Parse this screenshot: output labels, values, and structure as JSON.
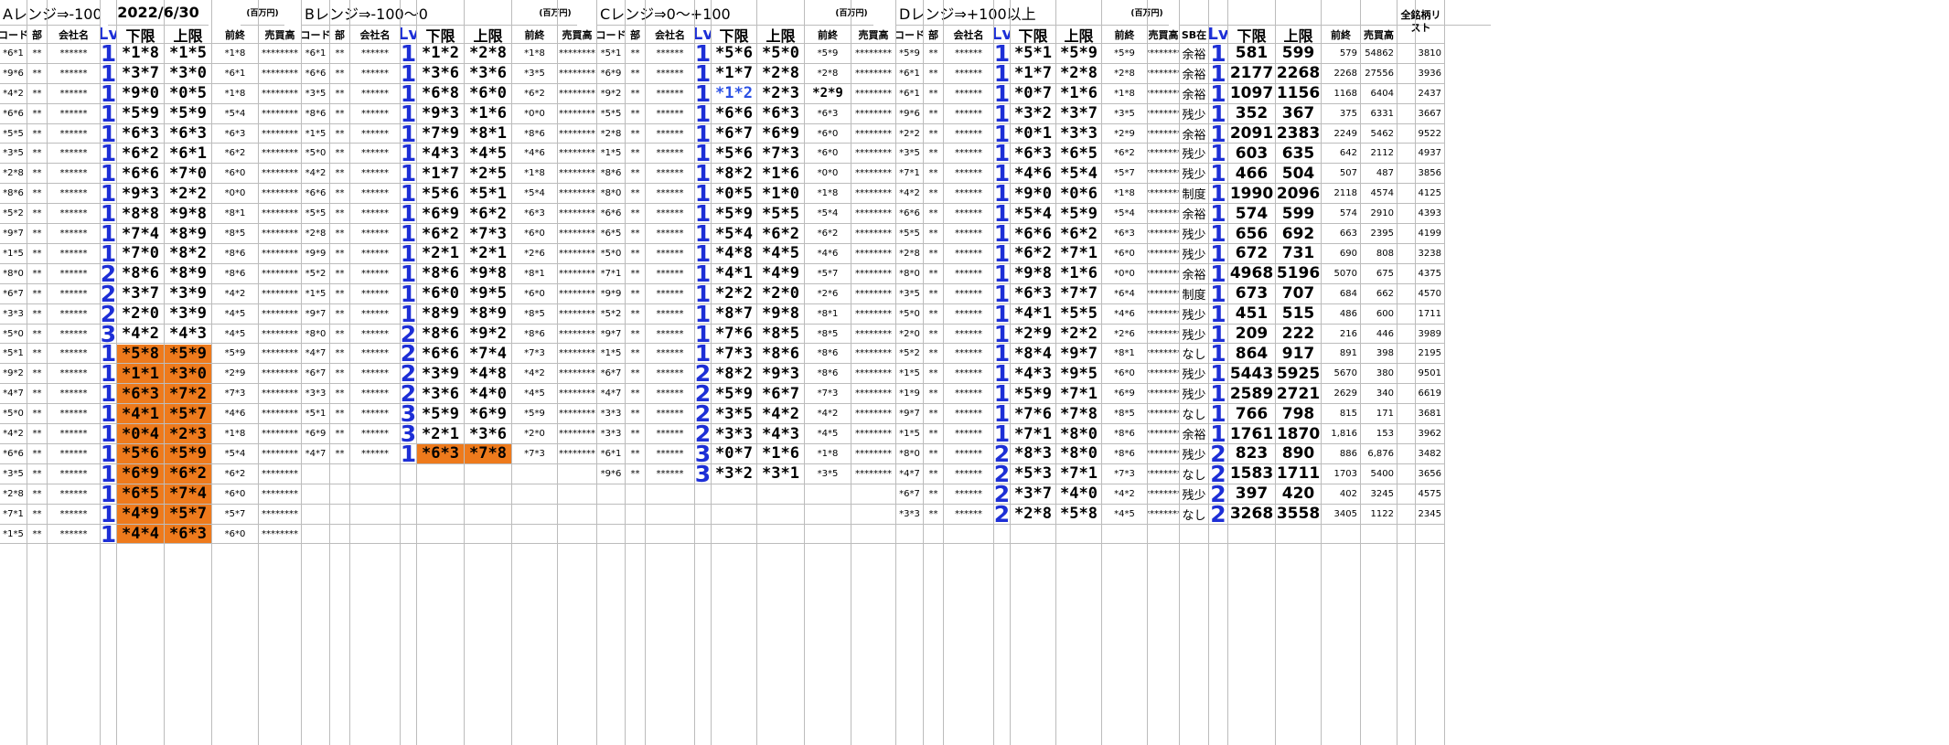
{
  "title": {
    "date": "2022/6/30",
    "units": "(百万円)"
  },
  "section_titles": {
    "A": "Aレンジ⇒-100以",
    "B": "Bレンジ⇒-100〜0",
    "C": "Cレンジ⇒0〜+100",
    "D": "Dレンジ⇒+100以上"
  },
  "headers": {
    "code": "コード",
    "bu": "部",
    "company": "会社名",
    "lv": "Lv",
    "lower": "下限",
    "upper": "上限",
    "prev": "前終",
    "sales": "売買高",
    "sb": "SB在",
    "all_list": "全銘柄リスト"
  },
  "mask": {
    "bu": "**",
    "company": "******",
    "sales": "********"
  },
  "colors": {
    "lv_blue": "#1d2fd6",
    "highlight_orange": "#ee7a1c",
    "grid": "#bcbcbc",
    "text_blue": "#2b50e3"
  },
  "A_rows": [
    {
      "code": "*6*1",
      "lv": "1",
      "lower": "*1*8",
      "upper": "*1*5",
      "prev": "*1*8"
    },
    {
      "code": "*9*6",
      "lv": "1",
      "lower": "*3*7",
      "upper": "*3*0",
      "prev": "*6*1"
    },
    {
      "code": "*4*2",
      "lv": "1",
      "lower": "*9*0",
      "upper": "*0*5",
      "prev": "*1*8"
    },
    {
      "code": "*6*6",
      "lv": "1",
      "lower": "*5*9",
      "upper": "*5*9",
      "prev": "*5*4"
    },
    {
      "code": "*5*5",
      "lv": "1",
      "lower": "*6*3",
      "upper": "*6*3",
      "prev": "*6*3"
    },
    {
      "code": "*3*5",
      "lv": "1",
      "lower": "*6*2",
      "upper": "*6*1",
      "prev": "*6*2"
    },
    {
      "code": "*2*8",
      "lv": "1",
      "lower": "*6*6",
      "upper": "*7*0",
      "prev": "*6*0"
    },
    {
      "code": "*8*6",
      "lv": "1",
      "lower": "*9*3",
      "upper": "*2*2",
      "prev": "*0*0"
    },
    {
      "code": "*5*2",
      "lv": "1",
      "lower": "*8*8",
      "upper": "*9*8",
      "prev": "*8*1"
    },
    {
      "code": "*9*7",
      "lv": "1",
      "lower": "*7*4",
      "upper": "*8*9",
      "prev": "*8*5"
    },
    {
      "code": "*1*5",
      "lv": "1",
      "lower": "*7*0",
      "upper": "*8*2",
      "prev": "*8*6"
    },
    {
      "code": "*8*0",
      "lv": "2",
      "lower": "*8*6",
      "upper": "*8*9",
      "prev": "*8*6"
    },
    {
      "code": "*6*7",
      "lv": "2",
      "lower": "*3*7",
      "upper": "*3*9",
      "prev": "*4*2"
    },
    {
      "code": "*3*3",
      "lv": "2",
      "lower": "*2*0",
      "upper": "*3*9",
      "prev": "*4*5"
    },
    {
      "code": "*5*0",
      "lv": "3",
      "lower": "*4*2",
      "upper": "*4*3",
      "prev": "*4*5"
    },
    {
      "code": "*5*1",
      "lv": "1",
      "lower": "*5*8",
      "upper": "*5*9",
      "prev": "*5*9",
      "hl": true
    },
    {
      "code": "*9*2",
      "lv": "1",
      "lower": "*1*1",
      "upper": "*3*0",
      "prev": "*2*9",
      "hl": true
    },
    {
      "code": "*4*7",
      "lv": "1",
      "lower": "*6*3",
      "upper": "*7*2",
      "prev": "*7*3",
      "hl": true
    },
    {
      "code": "*5*0",
      "lv": "1",
      "lower": "*4*1",
      "upper": "*5*7",
      "prev": "*4*6",
      "hl": true
    },
    {
      "code": "*4*2",
      "lv": "1",
      "lower": "*0*4",
      "upper": "*2*3",
      "prev": "*1*8",
      "hl": true
    },
    {
      "code": "*6*6",
      "lv": "1",
      "lower": "*5*6",
      "upper": "*5*9",
      "prev": "*5*4",
      "hl": true
    },
    {
      "code": "*3*5",
      "lv": "1",
      "lower": "*6*9",
      "upper": "*6*2",
      "prev": "*6*2",
      "hl": true
    },
    {
      "code": "*2*8",
      "lv": "1",
      "lower": "*6*5",
      "upper": "*7*4",
      "prev": "*6*0",
      "hl": true
    },
    {
      "code": "*7*1",
      "lv": "1",
      "lower": "*4*9",
      "upper": "*5*7",
      "prev": "*5*7",
      "hl": true
    },
    {
      "code": "*1*5",
      "lv": "1",
      "lower": "*4*4",
      "upper": "*6*3",
      "prev": "*6*0",
      "hl": true
    }
  ],
  "B_rows": [
    {
      "code": "*6*1",
      "lv": "1",
      "lower": "*1*2",
      "upper": "*2*8",
      "prev": "*1*8"
    },
    {
      "code": "*6*6",
      "lv": "1",
      "lower": "*3*6",
      "upper": "*3*6",
      "prev": "*3*5"
    },
    {
      "code": "*3*5",
      "lv": "1",
      "lower": "*6*8",
      "upper": "*6*0",
      "prev": "*6*2"
    },
    {
      "code": "*8*6",
      "lv": "1",
      "lower": "*9*3",
      "upper": "*1*6",
      "prev": "*0*0"
    },
    {
      "code": "*1*5",
      "lv": "1",
      "lower": "*7*9",
      "upper": "*8*1",
      "prev": "*8*6"
    },
    {
      "code": "*5*0",
      "lv": "1",
      "lower": "*4*3",
      "upper": "*4*5",
      "prev": "*4*6"
    },
    {
      "code": "*4*2",
      "lv": "1",
      "lower": "*1*7",
      "upper": "*2*5",
      "prev": "*1*8"
    },
    {
      "code": "*6*6",
      "lv": "1",
      "lower": "*5*6",
      "upper": "*5*1",
      "prev": "*5*4"
    },
    {
      "code": "*5*5",
      "lv": "1",
      "lower": "*6*9",
      "upper": "*6*2",
      "prev": "*6*3"
    },
    {
      "code": "*2*8",
      "lv": "1",
      "lower": "*6*2",
      "upper": "*7*3",
      "prev": "*6*0"
    },
    {
      "code": "*9*9",
      "lv": "1",
      "lower": "*2*1",
      "upper": "*2*1",
      "prev": "*2*6"
    },
    {
      "code": "*5*2",
      "lv": "1",
      "lower": "*8*6",
      "upper": "*9*8",
      "prev": "*8*1"
    },
    {
      "code": "*1*5",
      "lv": "1",
      "lower": "*6*0",
      "upper": "*9*5",
      "prev": "*6*0"
    },
    {
      "code": "*9*7",
      "lv": "1",
      "lower": "*8*9",
      "upper": "*8*9",
      "prev": "*8*5"
    },
    {
      "code": "*8*0",
      "lv": "2",
      "lower": "*8*6",
      "upper": "*9*2",
      "prev": "*8*6"
    },
    {
      "code": "*4*7",
      "lv": "2",
      "lower": "*6*6",
      "upper": "*7*4",
      "prev": "*7*3"
    },
    {
      "code": "*6*7",
      "lv": "2",
      "lower": "*3*9",
      "upper": "*4*8",
      "prev": "*4*2"
    },
    {
      "code": "*3*3",
      "lv": "2",
      "lower": "*3*6",
      "upper": "*4*0",
      "prev": "*4*5"
    },
    {
      "code": "*5*1",
      "lv": "3",
      "lower": "*5*9",
      "upper": "*6*9",
      "prev": "*5*9"
    },
    {
      "code": "*6*9",
      "lv": "3",
      "lower": "*2*1",
      "upper": "*3*6",
      "prev": "*2*0"
    },
    {
      "code": "*4*7",
      "lv": "1",
      "lower": "*6*3",
      "upper": "*7*8",
      "prev": "*7*3",
      "hl": true
    }
  ],
  "C_rows": [
    {
      "code": "*5*1",
      "lv": "1",
      "lower": "*5*6",
      "upper": "*5*0",
      "prev": "*5*9"
    },
    {
      "code": "*6*9",
      "lv": "1",
      "lower": "*1*7",
      "upper": "*2*8",
      "prev": "*2*8"
    },
    {
      "code": "*9*2",
      "lv": "1",
      "lower": "*1*2",
      "upper": "*2*3",
      "prev": "*2*9",
      "lowblue": true,
      "prevbig": true
    },
    {
      "code": "*5*5",
      "lv": "1",
      "lower": "*6*6",
      "upper": "*6*3",
      "prev": "*6*3"
    },
    {
      "code": "*2*8",
      "lv": "1",
      "lower": "*6*7",
      "upper": "*6*9",
      "prev": "*6*0"
    },
    {
      "code": "*1*5",
      "lv": "1",
      "lower": "*5*6",
      "upper": "*7*3",
      "prev": "*6*0"
    },
    {
      "code": "*8*6",
      "lv": "1",
      "lower": "*8*2",
      "upper": "*1*6",
      "prev": "*0*0"
    },
    {
      "code": "*8*0",
      "lv": "1",
      "lower": "*0*5",
      "upper": "*1*0",
      "prev": "*1*8"
    },
    {
      "code": "*6*6",
      "lv": "1",
      "lower": "*5*9",
      "upper": "*5*5",
      "prev": "*5*4"
    },
    {
      "code": "*6*5",
      "lv": "1",
      "lower": "*5*4",
      "upper": "*6*2",
      "prev": "*6*2"
    },
    {
      "code": "*5*0",
      "lv": "1",
      "lower": "*4*8",
      "upper": "*4*5",
      "prev": "*4*6"
    },
    {
      "code": "*7*1",
      "lv": "1",
      "lower": "*4*1",
      "upper": "*4*9",
      "prev": "*5*7"
    },
    {
      "code": "*9*9",
      "lv": "1",
      "lower": "*2*2",
      "upper": "*2*0",
      "prev": "*2*6"
    },
    {
      "code": "*5*2",
      "lv": "1",
      "lower": "*8*7",
      "upper": "*9*8",
      "prev": "*8*1"
    },
    {
      "code": "*9*7",
      "lv": "1",
      "lower": "*7*6",
      "upper": "*8*5",
      "prev": "*8*5"
    },
    {
      "code": "*1*5",
      "lv": "1",
      "lower": "*7*3",
      "upper": "*8*6",
      "prev": "*8*6"
    },
    {
      "code": "*6*7",
      "lv": "2",
      "lower": "*8*2",
      "upper": "*9*3",
      "prev": "*8*6"
    },
    {
      "code": "*4*7",
      "lv": "2",
      "lower": "*5*9",
      "upper": "*6*7",
      "prev": "*7*3"
    },
    {
      "code": "*3*3",
      "lv": "2",
      "lower": "*3*5",
      "upper": "*4*2",
      "prev": "*4*2"
    },
    {
      "code": "*3*3",
      "lv": "2",
      "lower": "*3*3",
      "upper": "*4*3",
      "prev": "*4*5"
    },
    {
      "code": "*6*1",
      "lv": "3",
      "lower": "*0*7",
      "upper": "*1*6",
      "prev": "*1*8"
    },
    {
      "code": "*9*6",
      "lv": "3",
      "lower": "*3*2",
      "upper": "*3*1",
      "prev": "*3*5"
    }
  ],
  "D_rows": [
    {
      "code": "*5*9",
      "lv": "1",
      "lower": "*5*1",
      "upper": "*5*9",
      "prev": "*5*9",
      "sb": "余裕",
      "sblv": "1",
      "low": "581",
      "high": "599",
      "zen": "579",
      "vol": "54862",
      "list": "3810"
    },
    {
      "code": "*6*1",
      "lv": "1",
      "lower": "*1*7",
      "upper": "*2*8",
      "prev": "*2*8",
      "sb": "余裕",
      "sblv": "1",
      "low": "2177",
      "high": "2268",
      "zen": "2268",
      "vol": "27556",
      "list": "3936"
    },
    {
      "code": "*6*1",
      "lv": "1",
      "lower": "*0*7",
      "upper": "*1*6",
      "prev": "*1*8",
      "sb": "余裕",
      "sblv": "1",
      "low": "1097",
      "high": "1156",
      "zen": "1168",
      "vol": "6404",
      "list": "2437"
    },
    {
      "code": "*9*6",
      "lv": "1",
      "lower": "*3*2",
      "upper": "*3*7",
      "prev": "*3*5",
      "sb": "残少",
      "sblv": "1",
      "low": "352",
      "high": "367",
      "zen": "375",
      "vol": "6331",
      "list": "3667"
    },
    {
      "code": "*2*2",
      "lv": "1",
      "lower": "*0*1",
      "upper": "*3*3",
      "prev": "*2*9",
      "sb": "余裕",
      "sblv": "1",
      "low": "2091",
      "high": "2383",
      "zen": "2249",
      "vol": "5462",
      "list": "9522"
    },
    {
      "code": "*3*5",
      "lv": "1",
      "lower": "*6*3",
      "upper": "*6*5",
      "prev": "*6*2",
      "sb": "残少",
      "sblv": "1",
      "low": "603",
      "high": "635",
      "zen": "642",
      "vol": "2112",
      "list": "4937"
    },
    {
      "code": "*7*1",
      "lv": "1",
      "lower": "*4*6",
      "upper": "*5*4",
      "prev": "*5*7",
      "sb": "残少",
      "sblv": "1",
      "low": "466",
      "high": "504",
      "zen": "507",
      "vol": "487",
      "list": "3856"
    },
    {
      "code": "*4*2",
      "lv": "1",
      "lower": "*9*0",
      "upper": "*0*6",
      "prev": "*1*8",
      "sb": "制度",
      "sblv": "1",
      "low": "1990",
      "high": "2096",
      "zen": "2118",
      "vol": "4574",
      "list": "4125"
    },
    {
      "code": "*6*6",
      "lv": "1",
      "lower": "*5*4",
      "upper": "*5*9",
      "prev": "*5*4",
      "sb": "余裕",
      "sblv": "1",
      "low": "574",
      "high": "599",
      "zen": "574",
      "vol": "2910",
      "list": "4393"
    },
    {
      "code": "*5*5",
      "lv": "1",
      "lower": "*6*6",
      "upper": "*6*2",
      "prev": "*6*3",
      "sb": "残少",
      "sblv": "1",
      "low": "656",
      "high": "692",
      "zen": "663",
      "vol": "2395",
      "list": "4199"
    },
    {
      "code": "*2*8",
      "lv": "1",
      "lower": "*6*2",
      "upper": "*7*1",
      "prev": "*6*0",
      "sb": "残少",
      "sblv": "1",
      "low": "672",
      "high": "731",
      "zen": "690",
      "vol": "808",
      "list": "3238"
    },
    {
      "code": "*8*0",
      "lv": "1",
      "lower": "*9*8",
      "upper": "*1*6",
      "prev": "*0*0",
      "sb": "余裕",
      "sblv": "1",
      "low": "4968",
      "high": "5196",
      "zen": "5070",
      "vol": "675",
      "list": "4375"
    },
    {
      "code": "*3*5",
      "lv": "1",
      "lower": "*6*3",
      "upper": "*7*7",
      "prev": "*6*4",
      "sb": "制度",
      "sblv": "1",
      "low": "673",
      "high": "707",
      "zen": "684",
      "vol": "662",
      "list": "4570"
    },
    {
      "code": "*5*0",
      "lv": "1",
      "lower": "*4*1",
      "upper": "*5*5",
      "prev": "*4*6",
      "sb": "残少",
      "sblv": "1",
      "low": "451",
      "high": "515",
      "zen": "486",
      "vol": "600",
      "list": "1711"
    },
    {
      "code": "*2*0",
      "lv": "1",
      "lower": "*2*9",
      "upper": "*2*2",
      "prev": "*2*6",
      "sb": "残少",
      "sblv": "1",
      "low": "209",
      "high": "222",
      "zen": "216",
      "vol": "446",
      "list": "3989"
    },
    {
      "code": "*5*2",
      "lv": "1",
      "lower": "*8*4",
      "upper": "*9*7",
      "prev": "*8*1",
      "sb": "なし",
      "sblv": "1",
      "low": "864",
      "high": "917",
      "zen": "891",
      "vol": "398",
      "list": "2195"
    },
    {
      "code": "*1*5",
      "lv": "1",
      "lower": "*4*3",
      "upper": "*9*5",
      "prev": "*6*0",
      "sb": "残少",
      "sblv": "1",
      "low": "5443",
      "high": "5925",
      "zen": "5670",
      "vol": "380",
      "list": "9501"
    },
    {
      "code": "*1*9",
      "lv": "1",
      "lower": "*5*9",
      "upper": "*7*1",
      "prev": "*6*9",
      "sb": "残少",
      "sblv": "1",
      "low": "2589",
      "high": "2721",
      "zen": "2629",
      "vol": "340",
      "list": "6619"
    },
    {
      "code": "*9*7",
      "lv": "1",
      "lower": "*7*6",
      "upper": "*7*8",
      "prev": "*8*5",
      "sb": "なし",
      "sblv": "1",
      "low": "766",
      "high": "798",
      "zen": "815",
      "vol": "171",
      "list": "3681"
    },
    {
      "code": "*1*5",
      "lv": "1",
      "lower": "*7*1",
      "upper": "*8*0",
      "prev": "*8*6",
      "sb": "余裕",
      "sblv": "1",
      "low": "1761",
      "high": "1870",
      "zen": "1,816",
      "vol": "153",
      "list": "3962"
    },
    {
      "code": "*8*0",
      "lv": "2",
      "lower": "*8*3",
      "upper": "*8*0",
      "prev": "*8*6",
      "sb": "残少",
      "sblv": "2",
      "low": "823",
      "high": "890",
      "zen": "886",
      "vol": "6,876",
      "list": "3482"
    },
    {
      "code": "*4*7",
      "lv": "2",
      "lower": "*5*3",
      "upper": "*7*1",
      "prev": "*7*3",
      "sb": "なし",
      "sblv": "2",
      "low": "1583",
      "high": "1711",
      "zen": "1703",
      "vol": "5400",
      "list": "3656"
    },
    {
      "code": "*6*7",
      "lv": "2",
      "lower": "*3*7",
      "upper": "*4*0",
      "prev": "*4*2",
      "sb": "残少",
      "sblv": "2",
      "low": "397",
      "high": "420",
      "zen": "402",
      "vol": "3245",
      "list": "4575"
    },
    {
      "code": "*3*3",
      "lv": "2",
      "lower": "*2*8",
      "upper": "*5*8",
      "prev": "*4*5",
      "sb": "なし",
      "sblv": "2",
      "low": "3268",
      "high": "3558",
      "zen": "3405",
      "vol": "1122",
      "list": "2345"
    }
  ]
}
